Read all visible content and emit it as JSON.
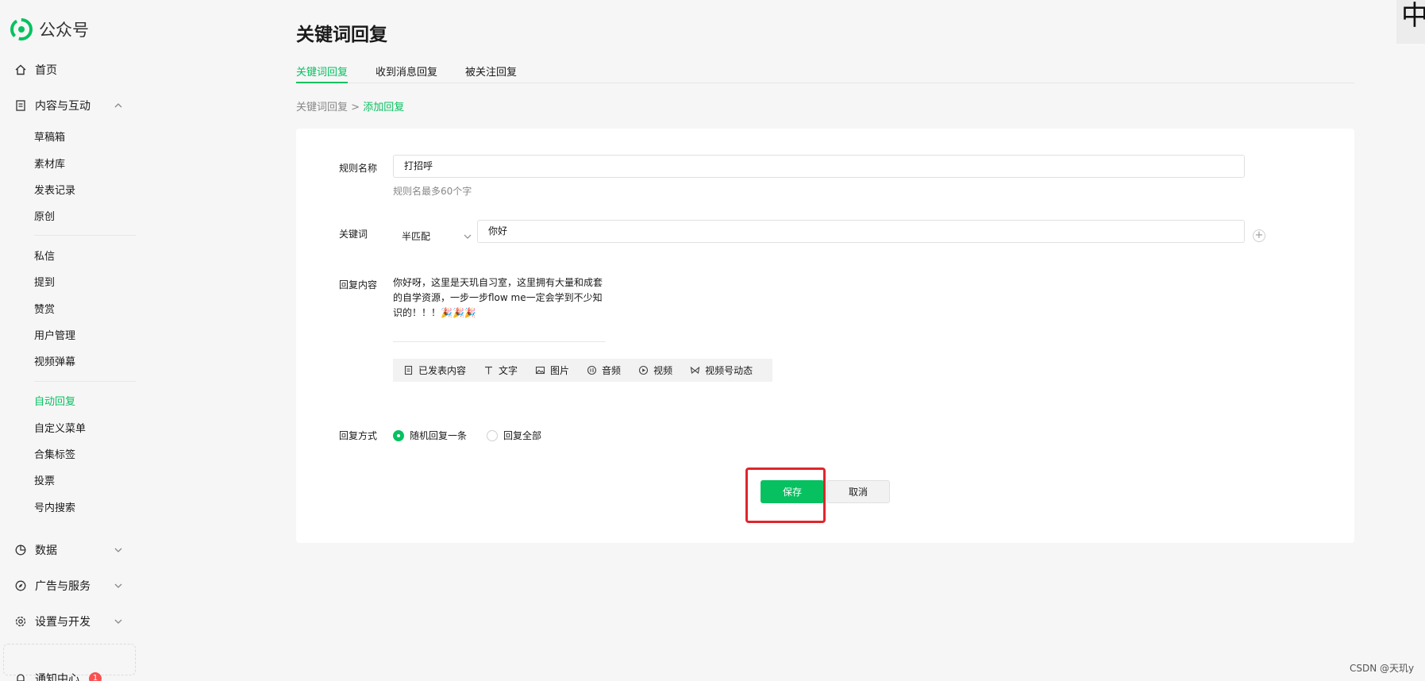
{
  "app": {
    "logo_text": "公众号"
  },
  "sidebar": {
    "home": "首页",
    "content_section": "内容与互动",
    "content_items": [
      "草稿箱",
      "素材库",
      "发表记录",
      "原创"
    ],
    "message_items": [
      "私信",
      "提到",
      "赞赏",
      "用户管理",
      "视频弹幕"
    ],
    "feature_items": [
      "自动回复",
      "自定义菜单",
      "合集标签",
      "投票",
      "号内搜索"
    ],
    "active_item": "自动回复",
    "data": "数据",
    "ads": "广告与服务",
    "settings": "设置与开发",
    "notify": "通知中心",
    "notify_count": "1"
  },
  "main": {
    "title": "关键词回复",
    "tabs": [
      "关键词回复",
      "收到消息回复",
      "被关注回复"
    ],
    "breadcrumb_parent": "关键词回复",
    "breadcrumb_sep": ">",
    "breadcrumb_current": "添加回复"
  },
  "form": {
    "rule_label": "规则名称",
    "rule_value": "打招呼",
    "rule_hint": "规则名最多60个字",
    "keyword_label": "关键词",
    "match_mode": "半匹配",
    "keyword_value": "你好",
    "add_symbol": "+",
    "reply_label": "回复内容",
    "reply_text": "你好呀，这里是天玑自习室，这里拥有大量和成套的自学资源，一步一步flow me一定会学到不少知识的！！！🎉🎉🎉",
    "tools": [
      "已发表内容",
      "文字",
      "图片",
      "音频",
      "视频",
      "视频号动态"
    ],
    "mode_label": "回复方式",
    "mode_options": [
      "随机回复一条",
      "回复全部"
    ],
    "save": "保存",
    "cancel": "取消"
  },
  "overlay": {
    "corner_char": "中",
    "watermark": "CSDN @天玑y"
  },
  "colors": {
    "accent": "#07c160",
    "highlight": "#e0262b"
  }
}
